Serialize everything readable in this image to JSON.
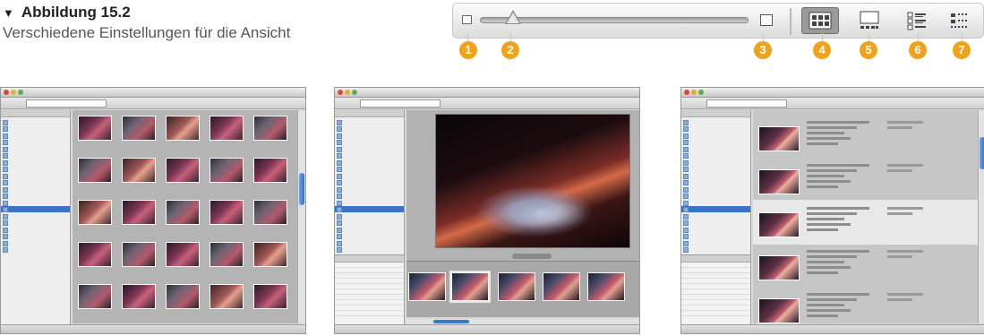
{
  "caption": {
    "marker": "▼",
    "figure_label": "Abbildung 15.2",
    "text": "Verschiedene Einstellungen für die Ansicht"
  },
  "toolbar": {
    "icons": [
      "small-thumbnail-icon",
      "thumbnail-size-slider",
      "large-thumbnail-icon",
      "thumbnail-grid-view-icon",
      "filmstrip-view-icon",
      "details-list-view-icon",
      "versions-view-icon"
    ],
    "markers": [
      "1",
      "2",
      "3",
      "4",
      "5",
      "6",
      "7"
    ],
    "accent_color": "#f0a21a"
  }
}
